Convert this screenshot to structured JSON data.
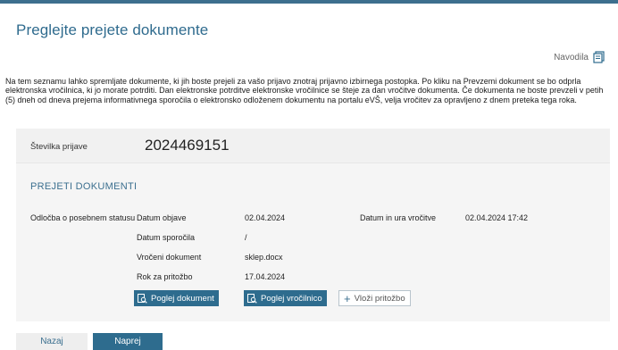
{
  "header": {
    "title": "Preglejte prejete dokumente"
  },
  "help": {
    "label": "Navodila",
    "icon": "document-help-icon"
  },
  "intro": {
    "text": "Na tem seznamu lahko spremljate dokumente, ki jih boste prejeli za vašo prijavo znotraj prijavno izbirnega postopka. Po kliku na Prevzemi dokument se bo odprla elektronska vročilnica, ki jo morate potrditi. Dan elektronske potrditve elektronske vročilnice se šteje za dan vročitve dokumenta. Če dokumenta ne boste prevzeli v petih (5) dneh od dneva prejema informativnega sporočila o elektronsko odloženem dokumentu na portalu eVŠ, velja vročitev za opravljeno z dnem preteka tega roka."
  },
  "application": {
    "label": "Številka prijave",
    "number": "2024469151"
  },
  "documents": {
    "section_title": "PREJETI DOKUMENTI",
    "document_name": "Odločba o posebnem statusu",
    "published_label": "Datum objave",
    "published_value": "02.04.2024",
    "delivery_label": "Datum in ura vročitve",
    "delivery_value": "02.04.2024 17:42",
    "message_label": "Datum sporočila",
    "message_value": "/",
    "delivered_doc_label": "Vročeni dokument",
    "delivered_doc_value": "sklep.docx",
    "appeal_label": "Rok za pritožbo",
    "appeal_value": "17.04.2024",
    "btn_view_document": "Poglej dokument",
    "btn_view_receipt": "Poglej vročilnico",
    "btn_submit_appeal": "Vloži pritožbo"
  },
  "nav": {
    "back": "Nazaj",
    "next": "Naprej"
  },
  "colors": {
    "accent": "#2e6c8e",
    "title": "#2f6b8e",
    "panel": "#f1f1f1"
  }
}
